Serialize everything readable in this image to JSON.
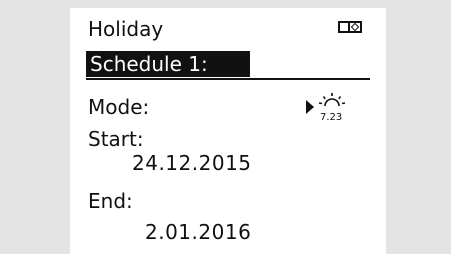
{
  "header": {
    "title": "Holiday",
    "battery_icon": "battery-icon"
  },
  "schedule": {
    "label": "Schedule 1:"
  },
  "mode": {
    "label": "Mode:",
    "icon": "holiday-sun-calendar-icon",
    "icon_date": "7.23"
  },
  "start": {
    "label": "Start:",
    "date": "24.12.2015"
  },
  "end": {
    "label": "End:",
    "date": "2.01.2016"
  },
  "colors": {
    "background": "#e3e3e3",
    "screen": "#ffffff",
    "foreground": "#111111"
  }
}
